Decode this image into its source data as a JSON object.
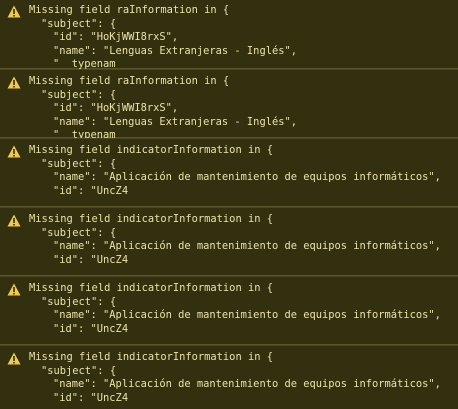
{
  "colors": {
    "background": "#232323",
    "warning_bg": "#333010",
    "warning_text": "#e9e3a6",
    "warning_icon": "#f2c94c",
    "border": "#5a5528"
  },
  "messages": [
    {
      "icon": "warning-icon",
      "header": "Missing field raInformation in {",
      "lines": [
        "\"subject\": {",
        "\"id\": \"HoKjWWI8rxS\",",
        "\"name\": \"Lenguas Extranjeras - Inglés\",",
        "\"__typenam"
      ]
    },
    {
      "icon": "warning-icon",
      "header": "Missing field raInformation in {",
      "lines": [
        "\"subject\": {",
        "\"id\": \"HoKjWWI8rxS\",",
        "\"name\": \"Lenguas Extranjeras - Inglés\",",
        "\"__typenam"
      ]
    },
    {
      "icon": "warning-icon",
      "header": "Missing field indicatorInformation in {",
      "lines": [
        "\"subject\": {",
        "\"name\": \"Aplicación de mantenimiento de equipos informáticos\",",
        "\"id\": \"UncZ4"
      ]
    },
    {
      "icon": "warning-icon",
      "header": "Missing field indicatorInformation in {",
      "lines": [
        "\"subject\": {",
        "\"name\": \"Aplicación de mantenimiento de equipos informáticos\",",
        "\"id\": \"UncZ4"
      ]
    },
    {
      "icon": "warning-icon",
      "header": "Missing field indicatorInformation in {",
      "lines": [
        "\"subject\": {",
        "\"name\": \"Aplicación de mantenimiento de equipos informáticos\",",
        "\"id\": \"UncZ4"
      ]
    },
    {
      "icon": "warning-icon",
      "header": "Missing field indicatorInformation in {",
      "lines": [
        "\"subject\": {",
        "\"name\": \"Aplicación de mantenimiento de equipos informáticos\",",
        "\"id\": \"UncZ4"
      ]
    }
  ]
}
